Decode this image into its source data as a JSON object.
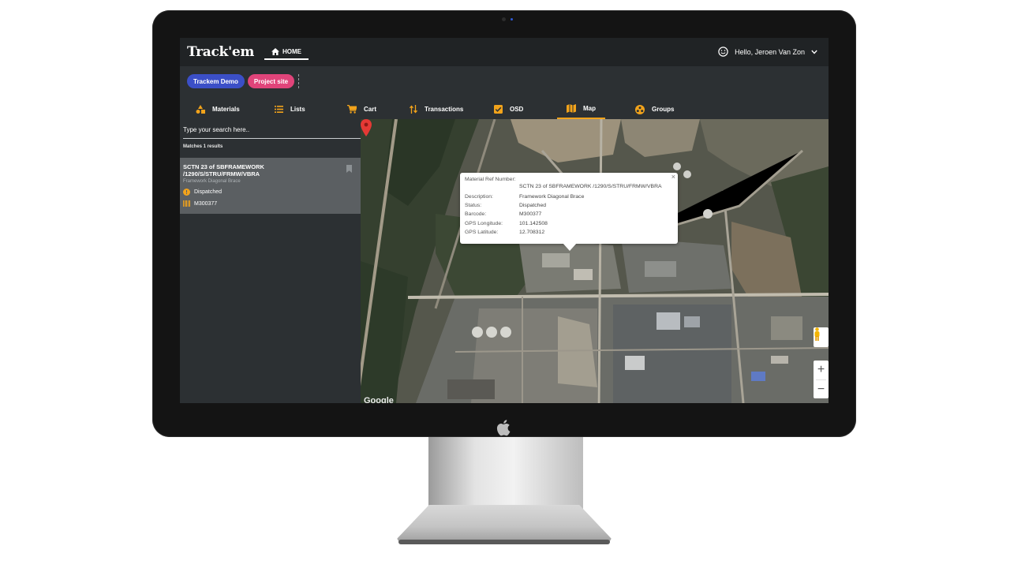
{
  "header": {
    "brand": "Track'em",
    "home_tab": "HOME",
    "greeting": "Hello, Jeroen Van Zon"
  },
  "chips": {
    "demo": "Trackem Demo",
    "site": "Project site"
  },
  "tabs": [
    {
      "label": "Materials",
      "icon": "shapes-icon"
    },
    {
      "label": "Lists",
      "icon": "list-icon"
    },
    {
      "label": "Cart",
      "icon": "cart-icon"
    },
    {
      "label": "Transactions",
      "icon": "transactions-icon"
    },
    {
      "label": "OSD",
      "icon": "check-square-icon"
    },
    {
      "label": "Map",
      "icon": "map-icon",
      "active": true
    },
    {
      "label": "Groups",
      "icon": "groups-icon"
    }
  ],
  "sidebar": {
    "search_placeholder": "Type your search here..",
    "matches": "Matches 1 results",
    "result": {
      "title": "SCTN 23 of SBFRAMEWORK /1290/S/STRU/FRMW/VBRA",
      "subtitle": "Framework Diagonal Brace",
      "status": "Dispatched",
      "barcode": "M300377"
    }
  },
  "popup": {
    "rows": [
      {
        "label": "Material Ref Number:",
        "value": "SCTN 23 of SBFRAMEWORK /1290/S/STRU/FRMW/VBRA"
      },
      {
        "label": "Description:",
        "value": "Framework Diagonal Brace"
      },
      {
        "label": "Status:",
        "value": "Dispatched"
      },
      {
        "label": "Barcode:",
        "value": "M300377"
      },
      {
        "label": "GPS Longitude:",
        "value": "101.142508"
      },
      {
        "label": "GPS Latitude:",
        "value": "12.708312"
      }
    ],
    "close": "×"
  },
  "map": {
    "attribution": "Google",
    "zoom_in": "+",
    "zoom_out": "−"
  },
  "colors": {
    "accent": "#f2a31b",
    "chip_demo": "#3b4fc7",
    "chip_site": "#e0447a",
    "marker": "#e53935"
  }
}
